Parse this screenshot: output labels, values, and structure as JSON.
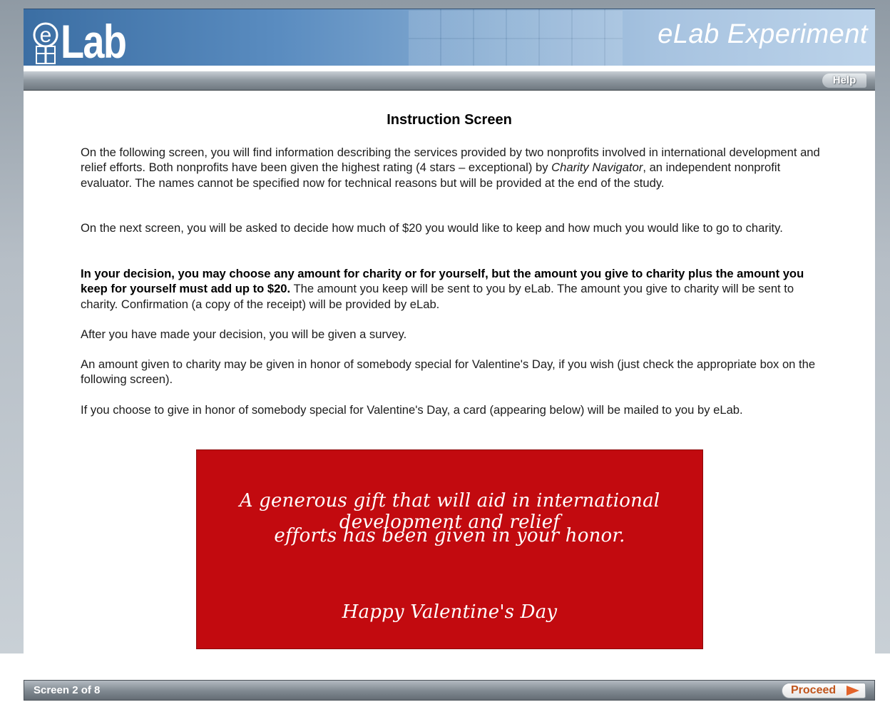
{
  "header": {
    "logo_text": "Lab",
    "logo_initial": "e",
    "title": "eLab Experiment"
  },
  "toolbar": {
    "help_label": "Help"
  },
  "main": {
    "title": "Instruction Screen",
    "p1_a": "On the following screen, you will find information describing the services provided by two nonprofits involved in international development and relief efforts. Both nonprofits have been given the highest rating (4 stars – exceptional) by ",
    "p1_italic": "Charity Navigator",
    "p1_b": ", an independent nonprofit evaluator. The names cannot be specified now for technical reasons but will be provided at the end of the study.",
    "p2": "On the next screen, you will be asked to decide how much of $20 you would like to keep and how much you would like to go to charity.",
    "p3_bold": "In your decision, you may choose any amount for charity or for yourself, but the amount you give to charity plus the amount you keep for yourself must add up to $20.",
    "p3_rest": " The amount you keep will be sent to you by eLab. The amount you give to charity will be sent to charity. Confirmation (a copy of the receipt) will be provided by eLab.",
    "p4": "After you have made your decision, you will be given a survey.",
    "p5": "An amount given to charity may be given in honor of somebody special for Valentine's Day, if you wish (just check the appropriate box on the following screen).",
    "p6": "If you choose to give in honor of somebody special for Valentine's Day, a card (appearing below) will be mailed to you by eLab."
  },
  "card": {
    "line1": "A generous gift that will aid in international development and relief",
    "line2": "efforts has been given in your honor.",
    "closing": "Happy Valentine's Day",
    "background_color": "#c20a0f"
  },
  "footer": {
    "screen_counter": "Screen 2 of 8",
    "proceed_label": "Proceed",
    "proceed_icon": "play-arrow-icon"
  }
}
